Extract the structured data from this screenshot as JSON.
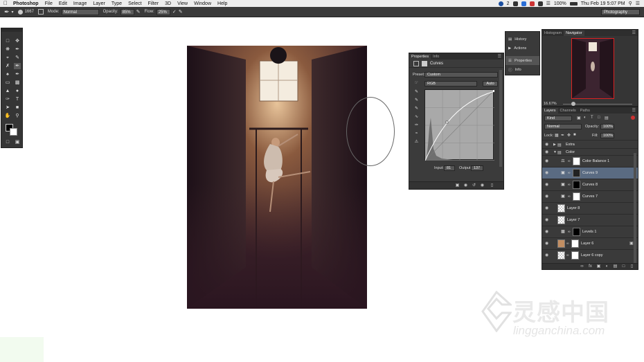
{
  "menubar": {
    "items": [
      "Photoshop",
      "File",
      "Edit",
      "Image",
      "Layer",
      "Type",
      "Select",
      "Filter",
      "3D",
      "View",
      "Window",
      "Help"
    ],
    "battery": "100%",
    "clock": "Thu Feb 19  5:07 PM",
    "tray_badge": "2"
  },
  "options": {
    "brush_size": "1667",
    "mode_label": "Mode:",
    "mode_value": "Normal",
    "opacity_label": "Opacity:",
    "opacity_value": "85%",
    "flow_label": "Flow:",
    "flow_value": "25%",
    "workspace": "Photography"
  },
  "properties": {
    "tabs": [
      "Properties",
      "Info"
    ],
    "title": "Curves",
    "preset_label": "Preset:",
    "preset_value": "Custom",
    "channel_value": "RGB",
    "auto_label": "Auto",
    "input_label": "Input:",
    "input_value": "81",
    "output_label": "Output:",
    "output_value": "137"
  },
  "dock": {
    "items": [
      "History",
      "Actions",
      "Properties",
      "Info"
    ]
  },
  "navigator": {
    "tabs": [
      "Histogram",
      "Navigator"
    ],
    "zoom": "16.67%"
  },
  "layers": {
    "tabs": [
      "Layers",
      "Channels",
      "Paths"
    ],
    "kind_value": "Kind",
    "blend_value": "Normal",
    "opacity_label": "Opacity:",
    "opacity_value": "100%",
    "lock_label": "Lock:",
    "fill_label": "Fill:",
    "fill_value": "100%",
    "list": [
      "Extra",
      "Color",
      "Color Balance 1",
      "Curves 9",
      "Curves 8",
      "Curves 7",
      "Layer 8",
      "Layer 7",
      "Levels 1",
      "Layer 6",
      "Layer 6 copy"
    ]
  },
  "watermark": {
    "cn": "灵感中国",
    "en": "lingganchina.com"
  }
}
